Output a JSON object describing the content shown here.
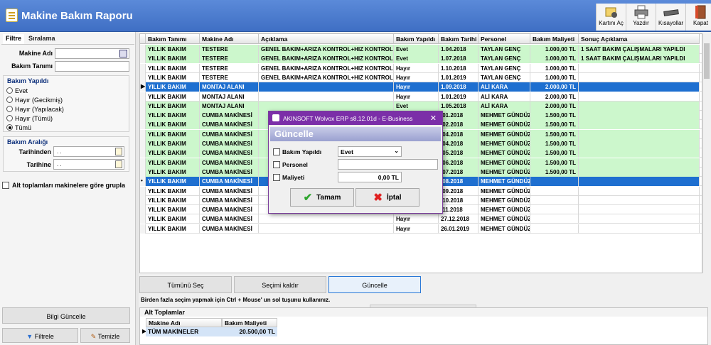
{
  "app": {
    "title": "Makine Bakım Raporu"
  },
  "toolbar": {
    "kart_ac": "Kartını Aç",
    "yazdir": "Yazdır",
    "kisayollar": "Kısayollar",
    "kapat": "Kapat"
  },
  "left": {
    "tab_filtre": "Filtre",
    "tab_siralama": "Sıralama",
    "makine_adi_label": "Makine Adı",
    "bakim_tanimi_label": "Bakım Tanımı",
    "bakim_yapildi_title": "Bakım Yapıldı",
    "radios": [
      "Evet",
      "Hayır (Gecikmiş)",
      "Hayır (Yapılacak)",
      "Hayır (Tümü)",
      "Tümü"
    ],
    "radio_selected_index": 4,
    "bakim_araligi_title": "Bakım Aralığı",
    "tarihinden_label": "Tarihinden",
    "tarihine_label": "Tarihine",
    "tarihinden_value": ". .",
    "tarihine_value": ". .",
    "grupla_label": "Alt toplamları makinelere göre grupla",
    "bilgi_guncelle": "Bilgi Güncelle",
    "filtrele": "Filtrele",
    "temizle": "Temizle"
  },
  "grid": {
    "columns": [
      "Bakım Tanımı",
      "Makine Adı",
      "Açıklama",
      "Bakım Yapıldı",
      "Bakım Tarihi",
      "Personel",
      "Bakım Maliyeti",
      "Sonuç Açıklama"
    ],
    "rows": [
      {
        "style": "green",
        "cells": [
          "YILLIK BAKIM",
          "TESTERE",
          "GENEL BAKIM+ARIZA KONTROL+HIZ KONTROL",
          "Evet",
          "1.04.2018",
          "TAYLAN GENÇ",
          "1.000,00 TL",
          "1 SAAT BAKIM ÇALIŞMALARI YAPILDI"
        ]
      },
      {
        "style": "green",
        "cells": [
          "YILLIK BAKIM",
          "TESTERE",
          "GENEL BAKIM+ARIZA KONTROL+HIZ KONTROL",
          "Evet",
          "1.07.2018",
          "TAYLAN GENÇ",
          "1.000,00 TL",
          "1 SAAT BAKIM ÇALIŞMALARI YAPILDI"
        ]
      },
      {
        "style": "white",
        "cells": [
          "YILLIK BAKIM",
          "TESTERE",
          "GENEL BAKIM+ARIZA KONTROL+HIZ KONTROL",
          "Hayır",
          "1.10.2018",
          "TAYLAN GENÇ",
          "1.000,00 TL",
          ""
        ]
      },
      {
        "style": "white",
        "cells": [
          "YILLIK BAKIM",
          "TESTERE",
          "GENEL BAKIM+ARIZA KONTROL+HIZ KONTROL",
          "Hayır",
          "1.01.2019",
          "TAYLAN GENÇ",
          "1.000,00 TL",
          ""
        ]
      },
      {
        "style": "sel",
        "cells": [
          "YILLIK BAKIM",
          "MONTAJ ALANI",
          "",
          "Hayır",
          "1.09.2018",
          "ALİ KARA",
          "2.000,00 TL",
          ""
        ]
      },
      {
        "style": "white",
        "cells": [
          "YILLIK BAKIM",
          "MONTAJ ALANI",
          "",
          "Hayır",
          "1.01.2019",
          "ALİ KARA",
          "2.000,00 TL",
          ""
        ]
      },
      {
        "style": "green",
        "cells": [
          "YILLIK BAKIM",
          "MONTAJ ALANI",
          "",
          "Evet",
          "1.05.2018",
          "ALİ KARA",
          "2.000,00 TL",
          ""
        ]
      },
      {
        "style": "green",
        "cells": [
          "YILLIK BAKIM",
          "CUMBA MAKİNESİ",
          "",
          "",
          ".01.2018",
          "MEHMET GÜNDÜZ",
          "1.500,00 TL",
          ""
        ]
      },
      {
        "style": "green",
        "cells": [
          "YILLIK BAKIM",
          "CUMBA MAKİNESİ",
          "",
          "",
          ".02.2018",
          "MEHMET GÜNDÜZ",
          "1.500,00 TL",
          ""
        ]
      },
      {
        "style": "green",
        "cells": [
          "YILLIK BAKIM",
          "CUMBA MAKİNESİ",
          "",
          "",
          ".04.2018",
          "MEHMET GÜNDÜZ",
          "1.500,00 TL",
          ""
        ]
      },
      {
        "style": "green",
        "cells": [
          "YILLIK BAKIM",
          "CUMBA MAKİNESİ",
          "",
          "",
          ".04.2018",
          "MEHMET GÜNDÜZ",
          "1.500,00 TL",
          ""
        ]
      },
      {
        "style": "green",
        "cells": [
          "YILLIK BAKIM",
          "CUMBA MAKİNESİ",
          "",
          "",
          ".05.2018",
          "MEHMET GÜNDÜZ",
          "1.500,00 TL",
          ""
        ]
      },
      {
        "style": "green",
        "cells": [
          "YILLIK BAKIM",
          "CUMBA MAKİNESİ",
          "",
          "",
          ".06.2018",
          "MEHMET GÜNDÜZ",
          "1.500,00 TL",
          ""
        ]
      },
      {
        "style": "green",
        "cells": [
          "YILLIK BAKIM",
          "CUMBA MAKİNESİ",
          "",
          "",
          ".07.2018",
          "MEHMET GÜNDÜZ",
          "1.500,00 TL",
          ""
        ]
      },
      {
        "style": "sel",
        "cells": [
          "YILLIK BAKIM",
          "CUMBA MAKİNESİ",
          "",
          "",
          ".08.2018",
          "MEHMET GÜNDÜZ",
          "",
          ""
        ]
      },
      {
        "style": "white",
        "cells": [
          "YILLIK BAKIM",
          "CUMBA MAKİNESİ",
          "",
          "",
          ".09.2018",
          "MEHMET GÜNDÜZ",
          "",
          ""
        ]
      },
      {
        "style": "white",
        "cells": [
          "YILLIK BAKIM",
          "CUMBA MAKİNESİ",
          "",
          "",
          ".10.2018",
          "MEHMET GÜNDÜZ",
          "",
          ""
        ]
      },
      {
        "style": "white",
        "cells": [
          "YILLIK BAKIM",
          "CUMBA MAKİNESİ",
          "",
          "",
          ".11.2018",
          "MEHMET GÜNDÜZ",
          "",
          ""
        ]
      },
      {
        "style": "white",
        "cells": [
          "YILLIK BAKIM",
          "CUMBA MAKİNESİ",
          "",
          "Hayır",
          "27.12.2018",
          "MEHMET GÜNDÜZ",
          "",
          ""
        ]
      },
      {
        "style": "white",
        "cells": [
          "YILLIK BAKIM",
          "CUMBA MAKİNESİ",
          "",
          "Hayır",
          "26.01.2019",
          "MEHMET GÜNDÜZ",
          "",
          ""
        ]
      }
    ]
  },
  "buttons": {
    "tumunu_sec": "Tümünü Seç",
    "secimi_kaldir": "Seçimi kaldır",
    "guncelle": "Güncelle"
  },
  "hint": "Birden fazla seçim yapmak için Ctrl + Mouse' un sol tuşunu kullanınız.",
  "subtotals": {
    "title": "Alt Toplamlar",
    "col1": "Makine Adı",
    "col2": "Bakım Maliyeti",
    "row_name": "TÜM MAKİNELER",
    "row_value": "20.500,00 TL"
  },
  "modal": {
    "window_title": "AKINSOFT Wolvox ERP s8.12.01d - E-Business",
    "heading": "Güncelle",
    "bakim_yapildi_label": "Bakım Yapıldı",
    "bakim_yapildi_value": "Evet",
    "personel_label": "Personel",
    "personel_value": "",
    "maliyeti_label": "Maliyeti",
    "maliyeti_value": "0,00 TL",
    "tamam": "Tamam",
    "iptal": "İptal",
    "close": "✕"
  }
}
